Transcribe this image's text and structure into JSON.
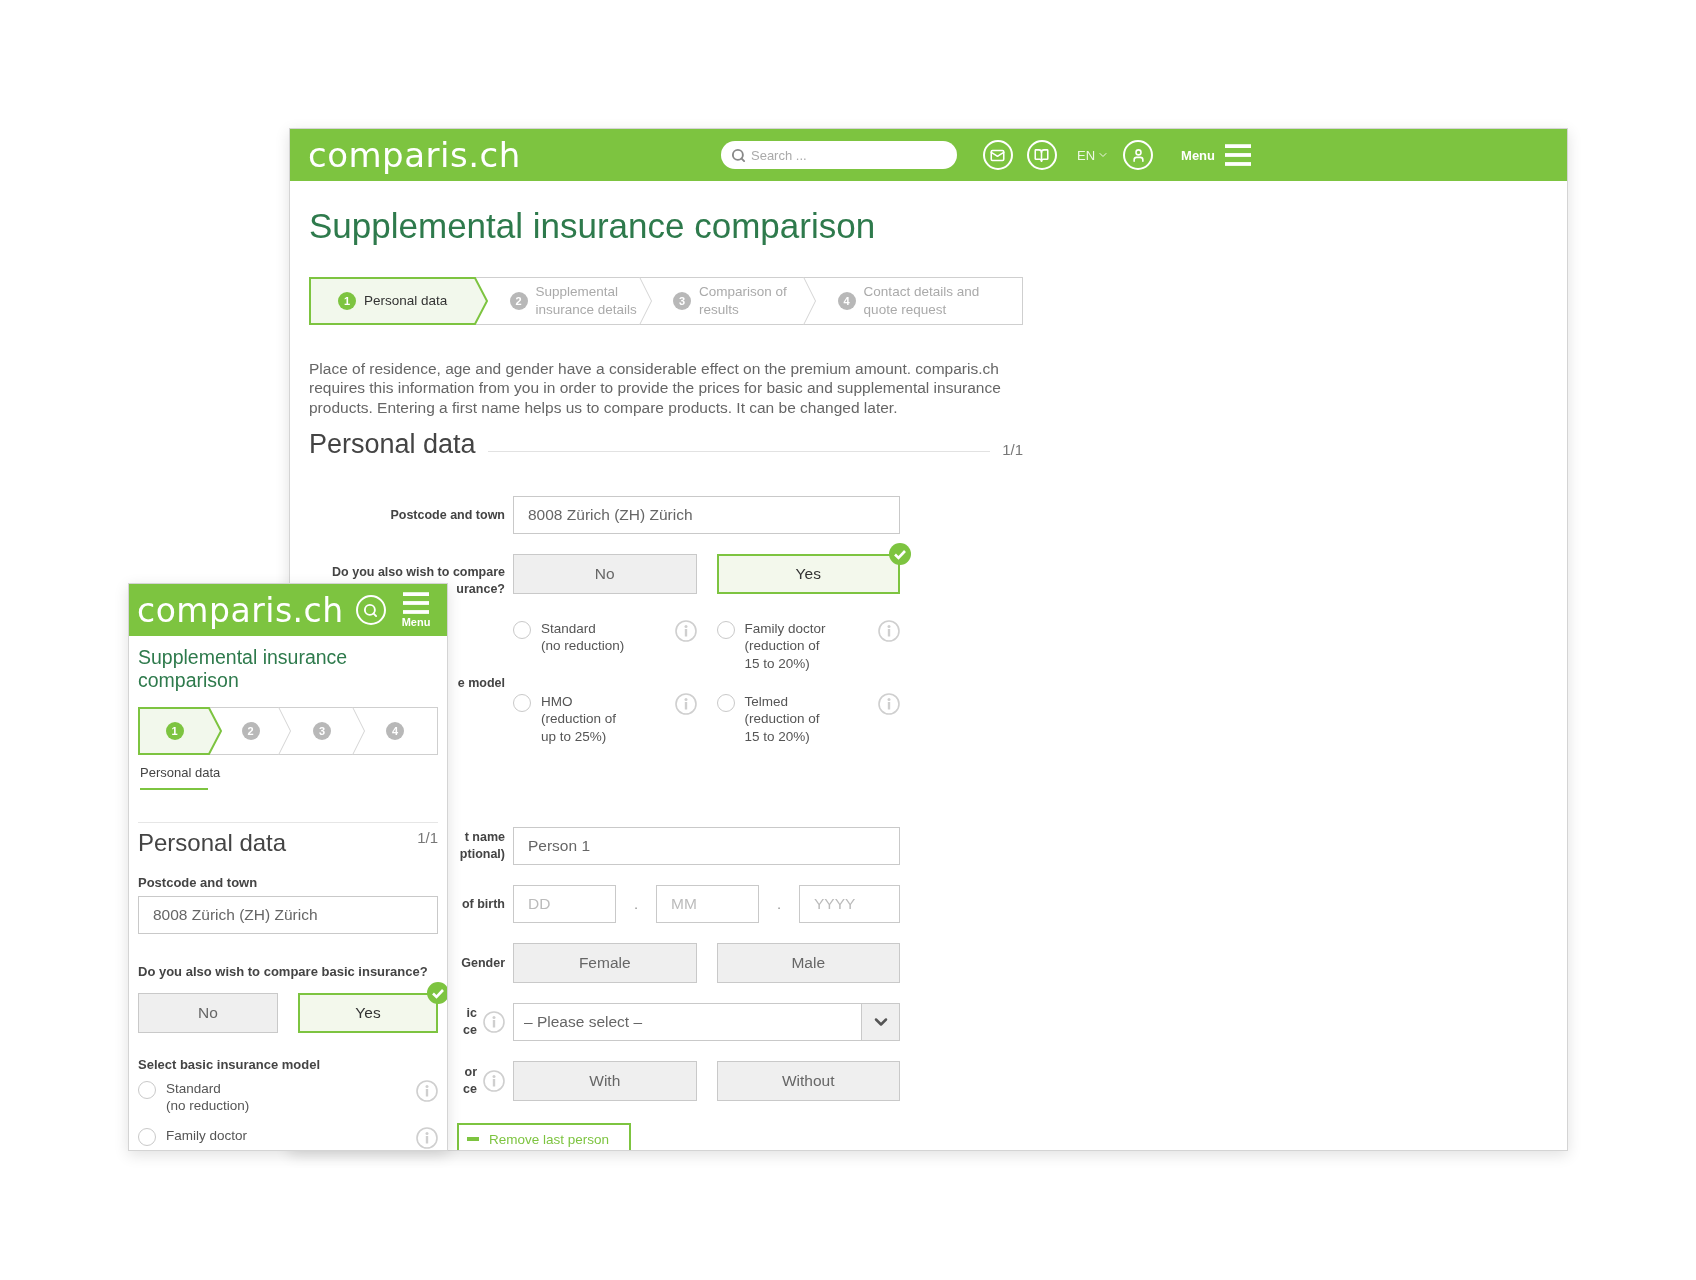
{
  "desktop": {
    "header": {
      "logo": "comparis.ch",
      "search_placeholder": "Search ...",
      "language": "EN",
      "menu_label": "Menu"
    },
    "title": "Supplemental insurance comparison",
    "steps": [
      {
        "number": "1",
        "label": "Personal data",
        "selected": true
      },
      {
        "number": "2",
        "label": "Supplemental insurance details",
        "selected": false
      },
      {
        "number": "3",
        "label": "Comparison of results",
        "selected": false
      },
      {
        "number": "4",
        "label": "Contact details and quote request",
        "selected": false
      }
    ],
    "intro": "Place of residence, age and gender have a considerable effect on the premium amount. comparis.ch requires this information from you in order to provide the prices for basic and supplemental insurance products. Entering a first name helps us to compare products. It can be changed later.",
    "section": {
      "title": "Personal data",
      "counter": "1/1"
    },
    "rows": [
      {
        "kind": "text",
        "label": [
          "Postcode and town"
        ],
        "value": "8008 Zürich (ZH) Zürich"
      },
      {
        "kind": "choice",
        "label": [
          "Do you also wish to compare",
          "urance?"
        ],
        "options": [
          {
            "label": "No",
            "selected": false
          },
          {
            "label": "Yes",
            "selected": true
          }
        ]
      },
      {
        "kind": "radios",
        "label": [
          "e model"
        ],
        "options": [
          {
            "label": [
              "Standard",
              "(no reduction)"
            ],
            "selected": false
          },
          {
            "label": [
              "Family doctor",
              "(reduction of",
              "15 to 20%)"
            ],
            "selected": false
          },
          {
            "label": [
              "HMO",
              "(reduction of",
              "up to 25%)"
            ],
            "selected": false
          },
          {
            "label": [
              "Telmed",
              "(reduction of",
              "15 to 20%)"
            ],
            "selected": false
          }
        ]
      },
      {
        "kind": "text",
        "label": [
          "t name",
          "ptional)"
        ],
        "value": "Person 1"
      },
      {
        "kind": "date",
        "label": [
          "of birth"
        ],
        "fields": [
          {
            "placeholder": "DD"
          },
          {
            "placeholder": "MM"
          },
          {
            "placeholder": "YYYY"
          }
        ],
        "separator": "."
      },
      {
        "kind": "choice",
        "label": [
          "Gender"
        ],
        "options": [
          {
            "label": "Female",
            "selected": false
          },
          {
            "label": "Male",
            "selected": false
          }
        ]
      },
      {
        "kind": "select",
        "label": [
          "ic",
          "ce"
        ],
        "info": true,
        "placeholder": "– Please select –"
      },
      {
        "kind": "choice",
        "label": [
          "or",
          "ce"
        ],
        "info": true,
        "options": [
          {
            "label": "With",
            "selected": false
          },
          {
            "label": "Without",
            "selected": false
          }
        ]
      }
    ],
    "remove_button": "Remove last person"
  },
  "mobile": {
    "logo": "comparis.ch",
    "menu_label": "Menu",
    "title": "Supplemental insurance comparison",
    "steps": [
      {
        "number": "1",
        "selected": true
      },
      {
        "number": "2",
        "selected": false
      },
      {
        "number": "3",
        "selected": false
      },
      {
        "number": "4",
        "selected": false
      }
    ],
    "step_caption": "Personal data",
    "section": {
      "title": "Personal data",
      "counter": "1/1"
    },
    "postcode": {
      "label": "Postcode and town",
      "value": "8008 Zürich (ZH) Zürich"
    },
    "basic": {
      "label": "Do you also wish to compare basic insurance?",
      "options": [
        {
          "label": "No",
          "selected": false
        },
        {
          "label": "Yes",
          "selected": true
        }
      ]
    },
    "model": {
      "label": "Select basic insurance model",
      "options": [
        {
          "label": [
            "Standard",
            "(no reduction)"
          ],
          "selected": false
        },
        {
          "label": [
            "Family doctor"
          ],
          "selected": false
        }
      ]
    }
  }
}
